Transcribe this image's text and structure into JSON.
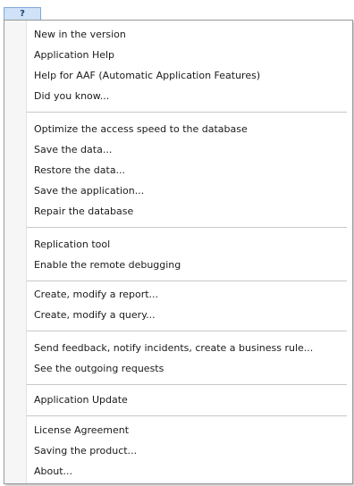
{
  "menubar": {
    "help_tab_label": "?"
  },
  "menu": {
    "groups": [
      [
        "New in the version",
        "Application Help",
        "Help for AAF (Automatic Application Features)",
        "Did you know..."
      ],
      [
        "Optimize the access speed to the database",
        "Save the data...",
        "Restore the data...",
        "Save the application...",
        "Repair the database"
      ],
      [
        "Replication tool",
        "Enable the remote debugging"
      ],
      [
        "Create, modify a report...",
        "Create, modify a query..."
      ],
      [
        "Send feedback, notify incidents, create a business rule...",
        "See the outgoing requests"
      ],
      [
        "Application Update"
      ],
      [
        "License Agreement",
        "Saving the product...",
        "About..."
      ]
    ]
  }
}
